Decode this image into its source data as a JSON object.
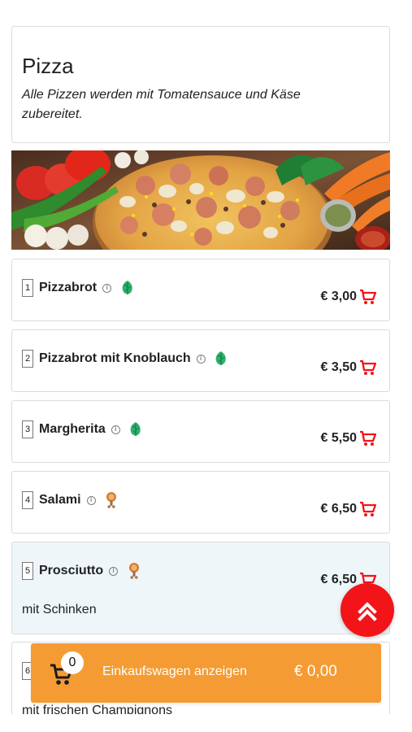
{
  "section": {
    "title": "Pizza",
    "description": "Alle Pizzen werden mit Tomatensauce und Käse zubereitet."
  },
  "products": [
    {
      "number": "1",
      "name": "Pizzabrot",
      "price": "€ 3,00",
      "tag_icon": "leaf-icon",
      "description": ""
    },
    {
      "number": "2",
      "name": "Pizzabrot mit Knoblauch",
      "price": "€ 3,50",
      "tag_icon": "leaf-icon",
      "description": ""
    },
    {
      "number": "3",
      "name": "Margherita",
      "price": "€ 5,50",
      "tag_icon": "leaf-icon",
      "description": ""
    },
    {
      "number": "4",
      "name": "Salami",
      "price": "€ 6,50",
      "tag_icon": "meat-icon",
      "description": ""
    },
    {
      "number": "5",
      "name": "Prosciutto",
      "price": "€ 6,50",
      "tag_icon": "meat-icon",
      "description": "mit Schinken"
    },
    {
      "number": "6",
      "name": "",
      "price": "",
      "tag_icon": "",
      "description": "mit frischen Champignons"
    }
  ],
  "cart": {
    "count": "0",
    "label": "Einkaufswagen anzeigen",
    "total": "€ 0,00"
  },
  "icons": {
    "info": "info-icon",
    "cart": "cart-icon",
    "scroll_top": "double-chevron-up-icon"
  },
  "colors": {
    "accent_red": "#f21419",
    "cart_orange": "#f59b33",
    "highlight_blue": "#eef6fa",
    "leaf_green": "#2fb06d",
    "meat_orange": "#d47c2f"
  }
}
